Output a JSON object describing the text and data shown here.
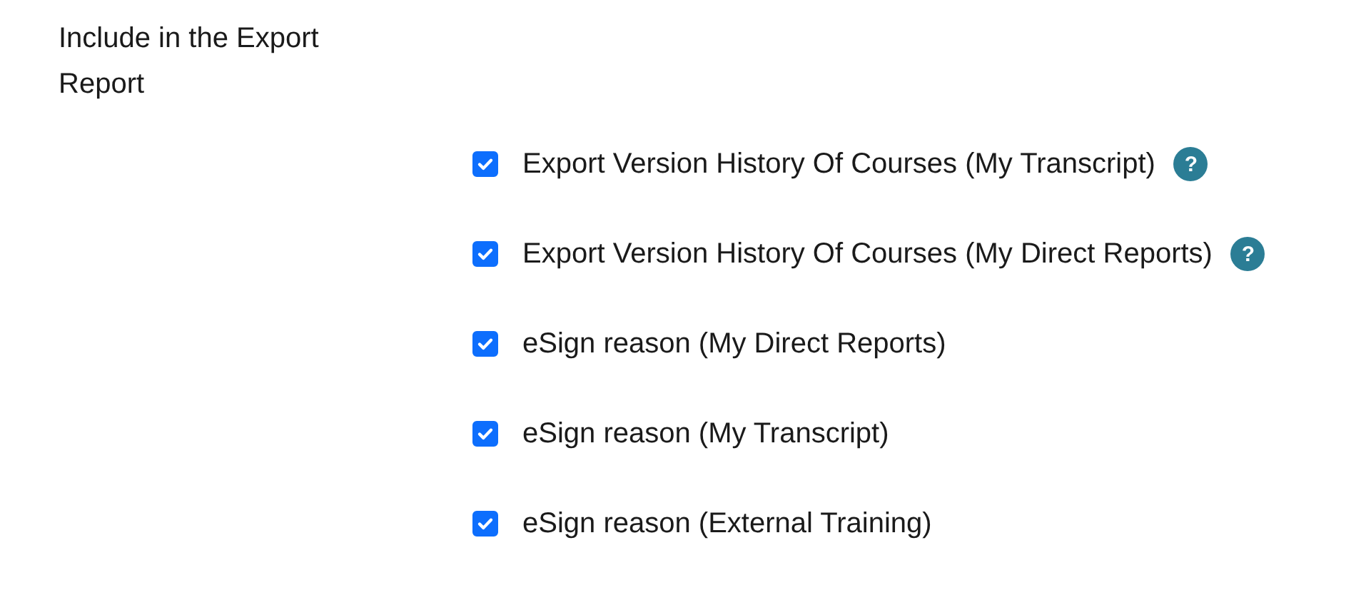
{
  "section_label": "Include in the Export Report",
  "options": [
    {
      "label": "Export Version History Of Courses (My Transcript)",
      "checked": true,
      "help": "?"
    },
    {
      "label": "Export Version History Of Courses (My Direct Reports)",
      "checked": true,
      "help": "?"
    },
    {
      "label": "eSign reason (My Direct Reports)",
      "checked": true
    },
    {
      "label": "eSign reason (My Transcript)",
      "checked": true
    },
    {
      "label": "eSign reason (External Training)",
      "checked": true
    }
  ]
}
